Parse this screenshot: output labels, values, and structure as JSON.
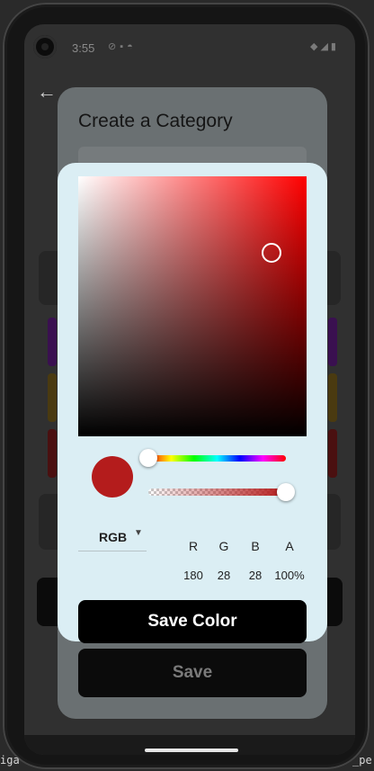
{
  "status_bar": {
    "time": "3:55"
  },
  "dialog": {
    "title": "Create a Category",
    "save_label": "Save"
  },
  "picker": {
    "selected_color": "#b41c1c",
    "hue_level": 0.0,
    "alpha_level": 1.0,
    "mode": "RGB",
    "channels": [
      {
        "label": "R",
        "value": "180"
      },
      {
        "label": "G",
        "value": "28"
      },
      {
        "label": "B",
        "value": "28"
      },
      {
        "label": "A",
        "value": "100%"
      }
    ],
    "save_color_label": "Save Color"
  },
  "background_text": {
    "left_fragment": "iga",
    "right_fragment": "_pe"
  },
  "colors": {
    "dialog_bg": "#6a7072",
    "picker_bg": "#dbeef4",
    "button_bg": "#000000"
  }
}
